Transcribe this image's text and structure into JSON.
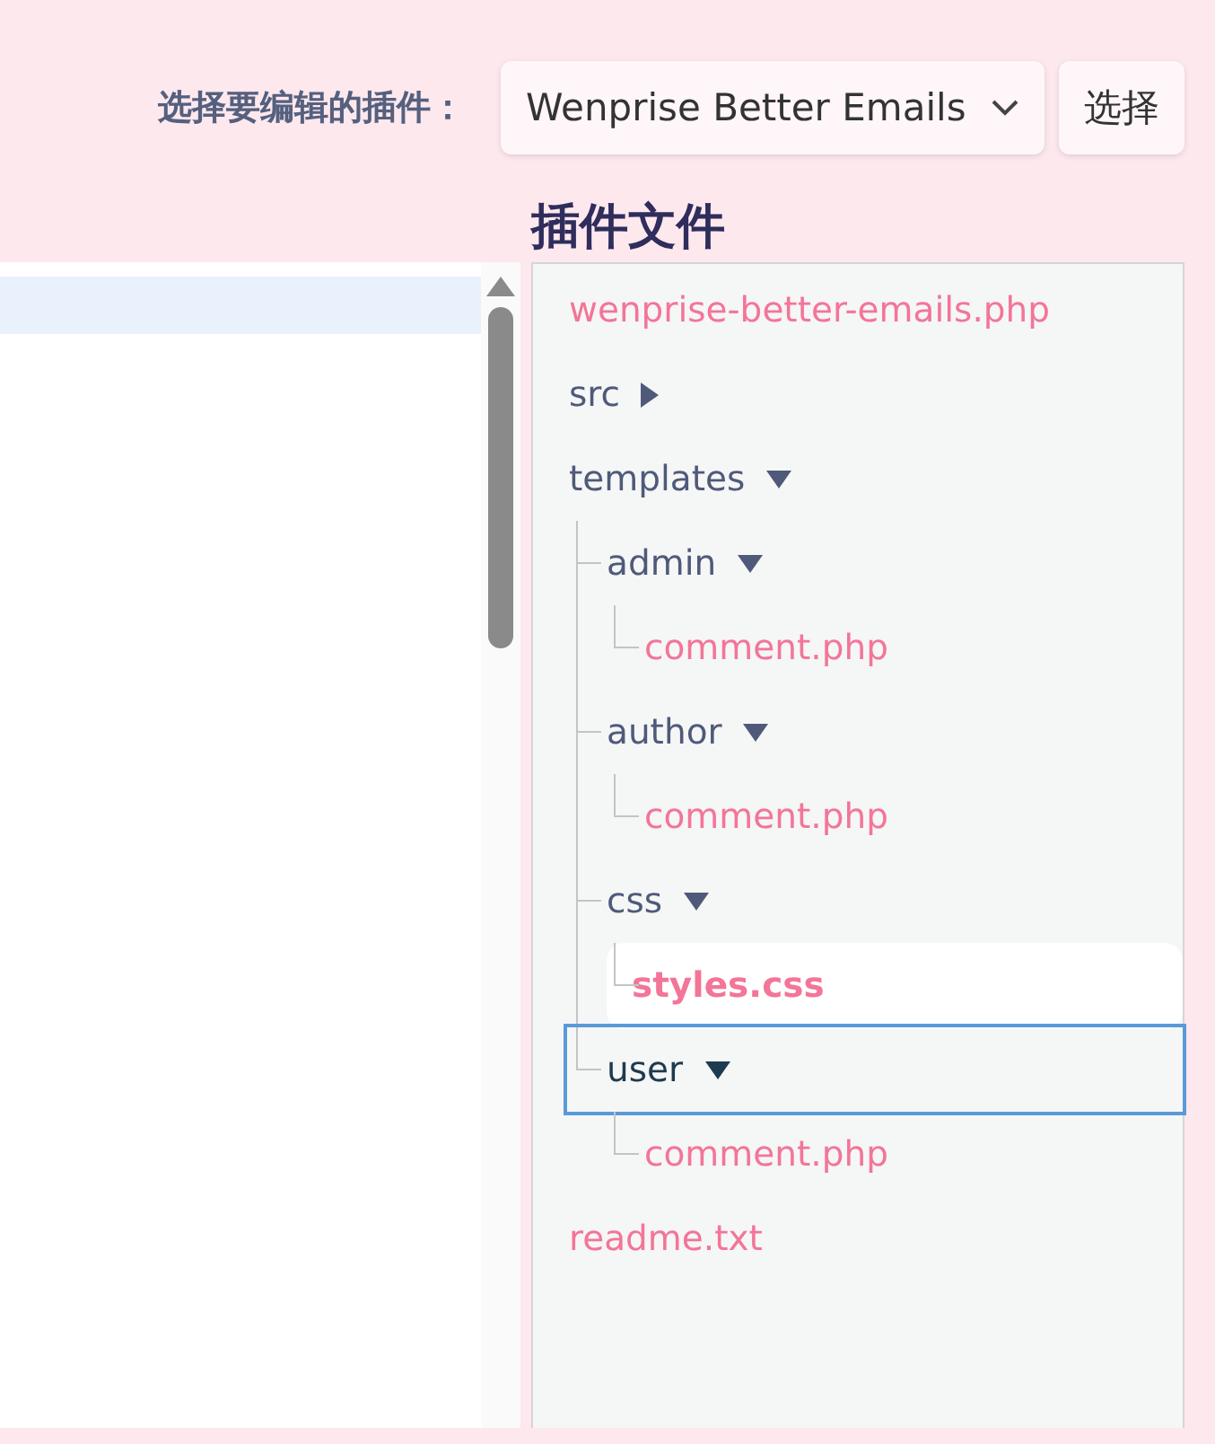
{
  "plugin_select": {
    "label": "选择要编辑的插件：",
    "value": "Wenprise Better Emails",
    "button": "选择"
  },
  "files": {
    "title": "插件文件",
    "tree": [
      {
        "name": "wenprise-better-emails.php",
        "kind": "file",
        "selected": false,
        "focused": false
      },
      {
        "name": "src",
        "kind": "folder",
        "expanded": false,
        "selected": false,
        "focused": false
      },
      {
        "name": "templates",
        "kind": "folder",
        "expanded": true,
        "selected": false,
        "focused": false,
        "children": [
          {
            "name": "admin",
            "kind": "folder",
            "expanded": true,
            "selected": false,
            "focused": false,
            "children": [
              {
                "name": "comment.php",
                "kind": "file",
                "selected": false,
                "focused": false
              }
            ]
          },
          {
            "name": "author",
            "kind": "folder",
            "expanded": true,
            "selected": false,
            "focused": false,
            "children": [
              {
                "name": "comment.php",
                "kind": "file",
                "selected": false,
                "focused": false
              }
            ]
          },
          {
            "name": "css",
            "kind": "folder",
            "expanded": true,
            "selected": false,
            "focused": false,
            "children": [
              {
                "name": "styles.css",
                "kind": "file",
                "selected": true,
                "focused": false
              }
            ]
          },
          {
            "name": "user",
            "kind": "folder",
            "expanded": true,
            "selected": false,
            "focused": true,
            "children": [
              {
                "name": "comment.php",
                "kind": "file",
                "selected": false,
                "focused": false
              }
            ]
          }
        ]
      },
      {
        "name": "readme.txt",
        "kind": "file",
        "selected": false,
        "focused": false
      }
    ]
  }
}
